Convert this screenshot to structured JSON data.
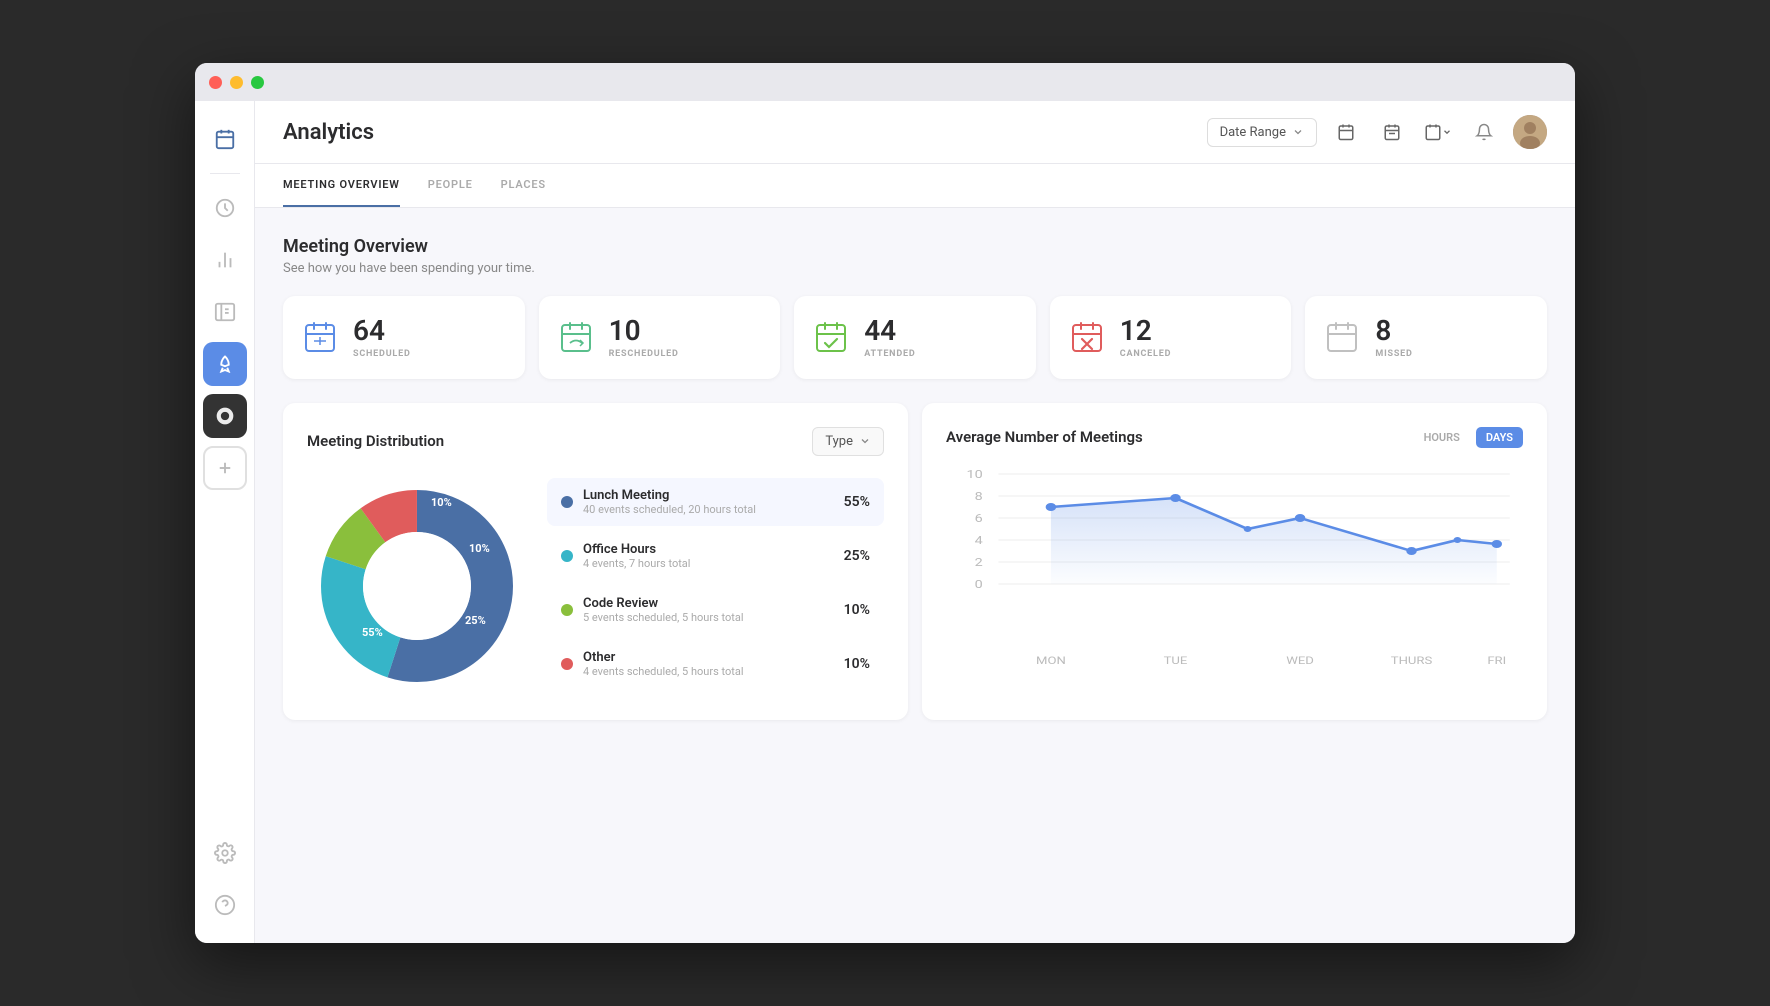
{
  "window": {
    "title": "Analytics"
  },
  "header": {
    "title": "Analytics",
    "date_range_label": "Date Range",
    "date_range_chevron": "▾"
  },
  "tabs": [
    {
      "id": "meeting-overview",
      "label": "Meeting Overview",
      "active": true
    },
    {
      "id": "people",
      "label": "People",
      "active": false
    },
    {
      "id": "places",
      "label": "Places",
      "active": false
    }
  ],
  "meeting_overview": {
    "title": "Meeting Overview",
    "subtitle": "See how you have been spending your time.",
    "stats": [
      {
        "id": "scheduled",
        "number": "64",
        "label": "Scheduled",
        "icon_color": "#5b8ce6"
      },
      {
        "id": "rescheduled",
        "number": "10",
        "label": "Rescheduled",
        "icon_color": "#5abf8c"
      },
      {
        "id": "attended",
        "number": "44",
        "label": "Attended",
        "icon_color": "#6cc24a"
      },
      {
        "id": "canceled",
        "number": "12",
        "label": "Canceled",
        "icon_color": "#e05c5c"
      },
      {
        "id": "missed",
        "number": "8",
        "label": "Missed",
        "icon_color": "#b0b0b0"
      }
    ]
  },
  "distribution": {
    "title": "Meeting Distribution",
    "type_label": "Type",
    "items": [
      {
        "id": "lunch",
        "name": "Lunch Meeting",
        "desc": "40 events scheduled, 20 hours total",
        "pct": "55%",
        "color": "#4a6fa5",
        "value": 55
      },
      {
        "id": "office",
        "name": "Office Hours",
        "desc": "4 events, 7 hours total",
        "pct": "25%",
        "color": "#36b5c8",
        "value": 25
      },
      {
        "id": "code",
        "name": "Code Review",
        "desc": "5 events scheduled, 5 hours total",
        "pct": "10%",
        "color": "#8abf3c",
        "value": 10
      },
      {
        "id": "other",
        "name": "Other",
        "desc": "4 events scheduled, 5 hours total",
        "pct": "10%",
        "color": "#e05c5c",
        "value": 10
      }
    ],
    "donut_labels": [
      {
        "text": "55%",
        "x": "35%",
        "y": "72%"
      },
      {
        "text": "25%",
        "x": "73%",
        "y": "65%"
      },
      {
        "text": "10%",
        "x": "78%",
        "y": "30%"
      },
      {
        "text": "10%",
        "x": "62%",
        "y": "14%"
      }
    ]
  },
  "avg_meetings": {
    "title": "Average Number of Meetings",
    "toggle_hours": "HOURS",
    "toggle_days": "DAYS",
    "active_toggle": "DAYS",
    "y_labels": [
      "10",
      "8",
      "6",
      "4",
      "2",
      "0"
    ],
    "x_labels": [
      "MON",
      "TUE",
      "WED",
      "THURS",
      "FRI"
    ],
    "data_points": [
      {
        "day": "MON",
        "value": 7
      },
      {
        "day": "TUE",
        "value": 7.8
      },
      {
        "day": "WED",
        "value": 5
      },
      {
        "day": "WED2",
        "value": 6.2
      },
      {
        "day": "THURS",
        "value": 3
      },
      {
        "day": "FRI",
        "value": 4
      },
      {
        "day": "FRI2",
        "value": 3.2
      }
    ]
  },
  "sidebar": {
    "items": [
      {
        "id": "calendar",
        "icon": "📅",
        "active": true
      },
      {
        "id": "clock",
        "icon": "🕐",
        "active": false
      },
      {
        "id": "chart",
        "icon": "📊",
        "active": false
      },
      {
        "id": "contacts",
        "icon": "👤",
        "active": false
      },
      {
        "id": "rocket",
        "icon": "🚀",
        "active": false,
        "style": "blue-bg"
      },
      {
        "id": "brand",
        "icon": "◉",
        "active": false,
        "style": "dark-bg"
      },
      {
        "id": "add",
        "icon": "+",
        "active": false,
        "style": "plus-btn"
      },
      {
        "id": "settings",
        "icon": "⚙",
        "active": false,
        "bottom": true
      },
      {
        "id": "help",
        "icon": "?",
        "active": false,
        "bottom": true
      }
    ]
  }
}
